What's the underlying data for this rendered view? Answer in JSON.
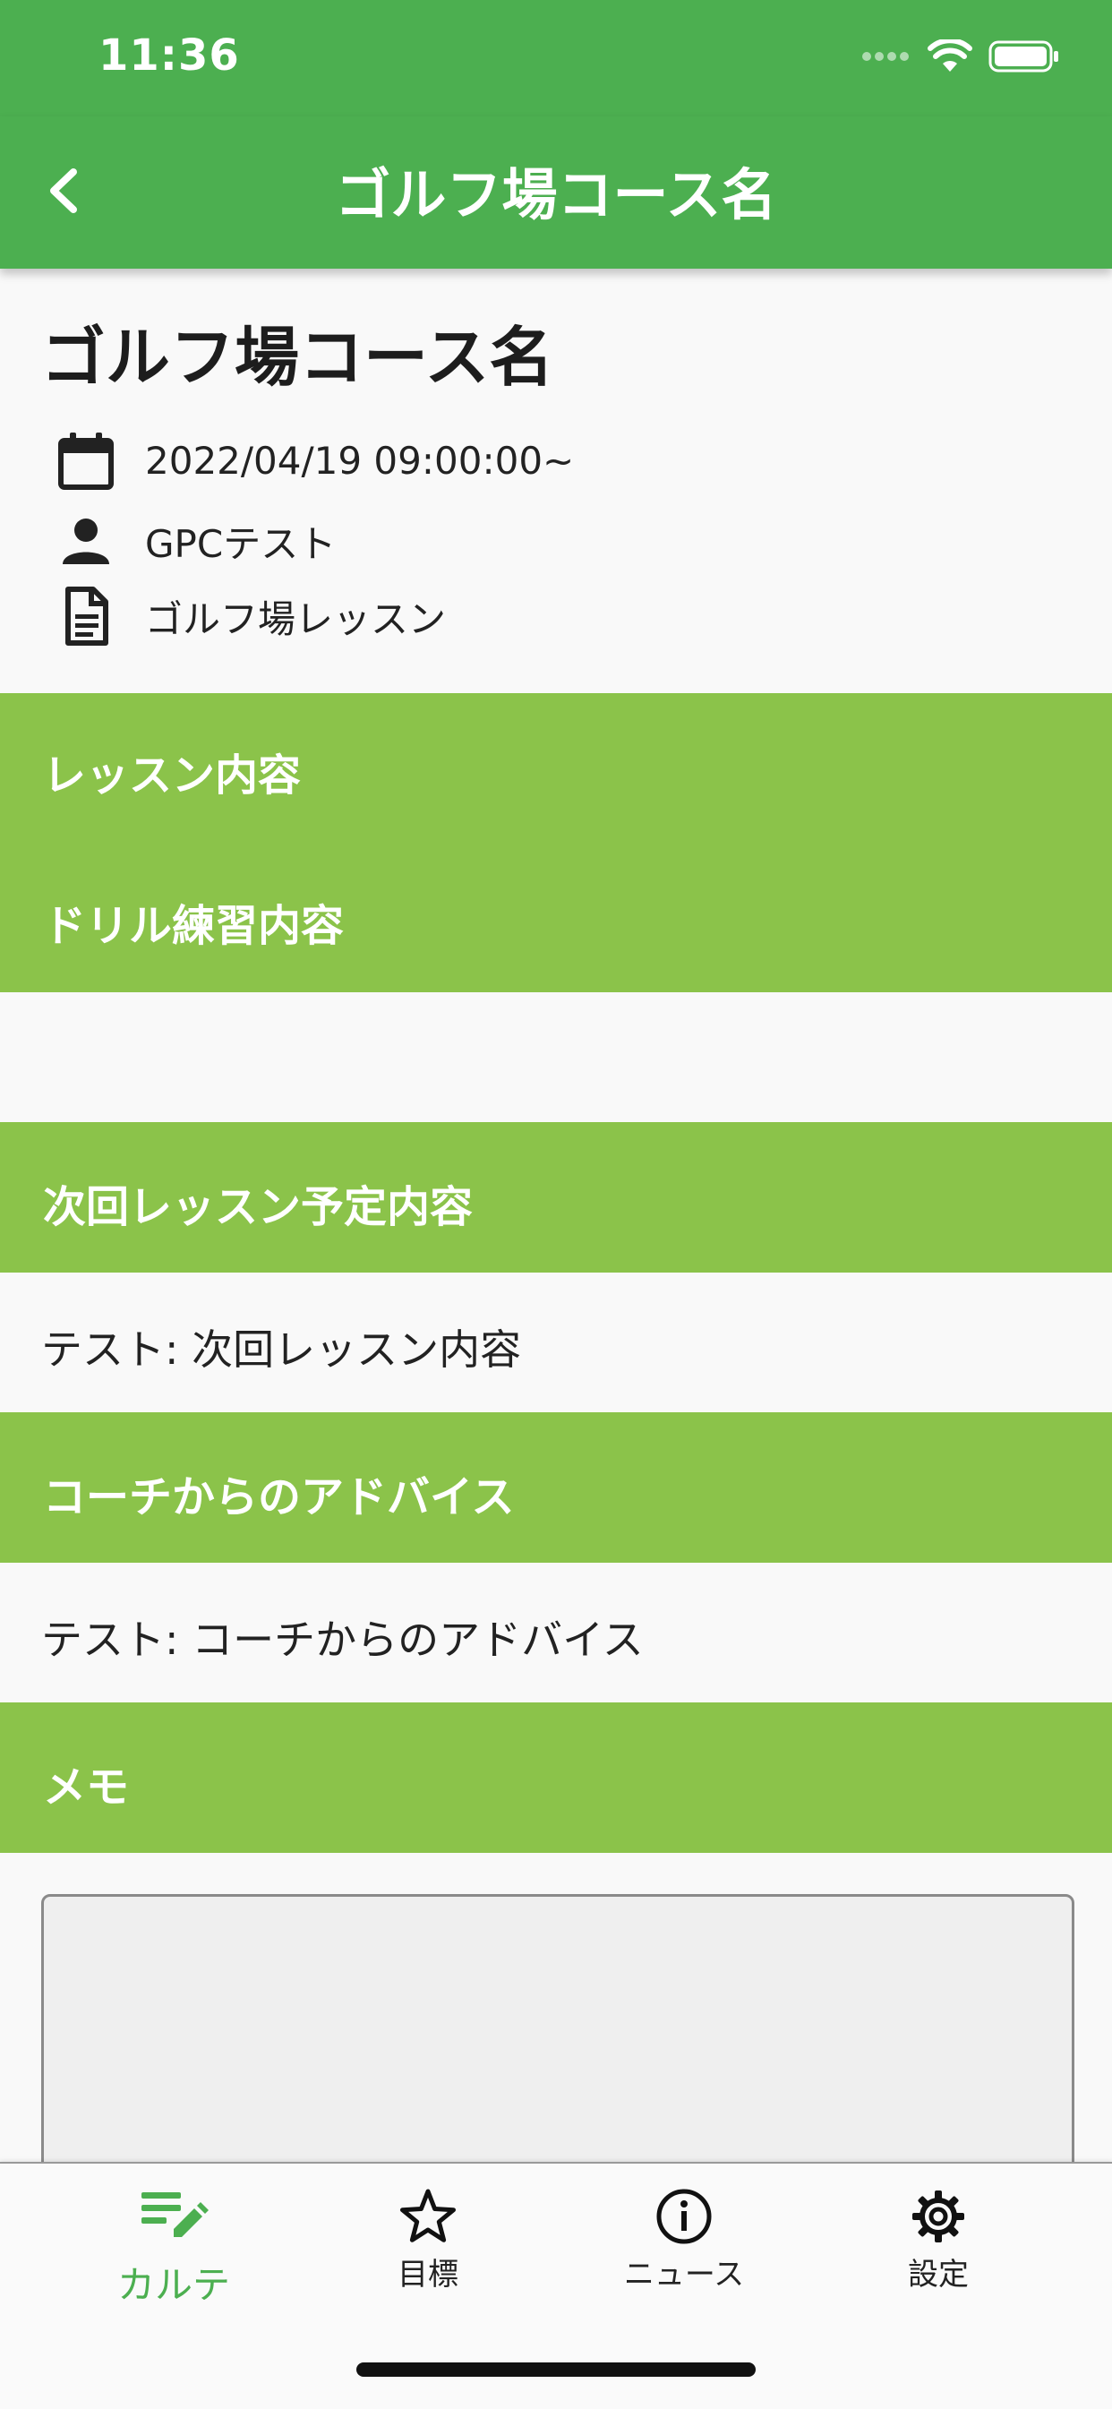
{
  "status_bar": {
    "time": "11:36"
  },
  "app_bar": {
    "title": "ゴルフ場コース名"
  },
  "info": {
    "title": "ゴルフ場コース名",
    "date": "2022/04/19 09:00:00~",
    "coach": "GPCテスト",
    "lesson_type": "ゴルフ場レッスン"
  },
  "sections": {
    "lesson_content": {
      "header": "レッスン内容"
    },
    "drill": {
      "header": "ドリル練習内容"
    },
    "next_lesson": {
      "header": "次回レッスン予定内容",
      "body": "テスト: 次回レッスン内容"
    },
    "advice": {
      "header": "コーチからのアドバイス",
      "body": "テスト: コーチからのアドバイス"
    },
    "memo": {
      "header": "メモ"
    }
  },
  "bottom_nav": {
    "items": [
      {
        "label": "カルテ",
        "icon": "edit-note-icon",
        "active": true
      },
      {
        "label": "目標",
        "icon": "star-icon",
        "active": false
      },
      {
        "label": "ニュース",
        "icon": "info-icon",
        "active": false
      },
      {
        "label": "設定",
        "icon": "gear-icon",
        "active": false
      }
    ]
  },
  "colors": {
    "app_bar": "#4caf50",
    "section_header": "#8bc34a",
    "active_nav": "#4caf50"
  }
}
